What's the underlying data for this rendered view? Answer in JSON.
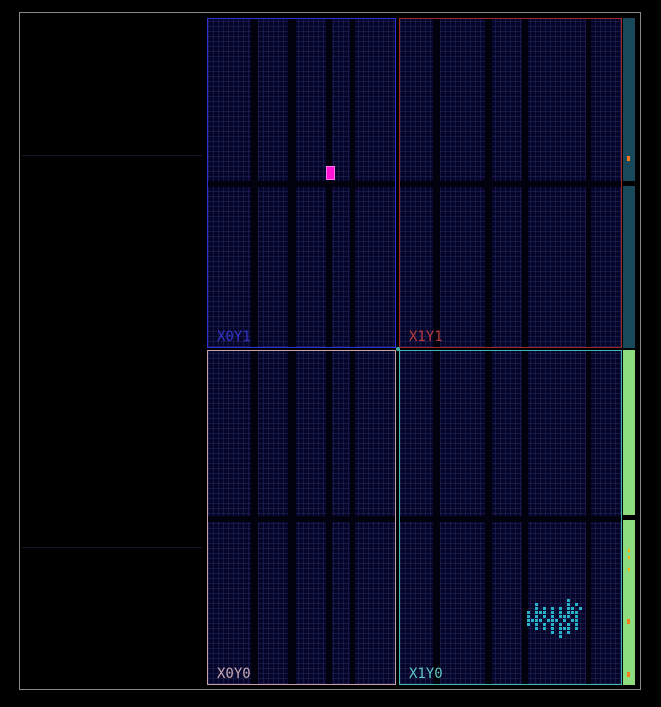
{
  "device_view": {
    "regions": [
      {
        "id": "x0y1",
        "label": "X0Y1",
        "border_color": "#3030d8",
        "label_color": "#3434c8"
      },
      {
        "id": "x1y1",
        "label": "X1Y1",
        "border_color": "#a02828",
        "label_color": "#b83a3a"
      },
      {
        "id": "x0y0",
        "label": "X0Y0",
        "border_color": "#c8a0a8",
        "label_color": "#c8a8b0"
      },
      {
        "id": "x1y0",
        "label": "X1Y0",
        "border_color": "#3fb5b0",
        "label_color": "#5ec7c2"
      }
    ],
    "io_strip_upper_color": "#17495a",
    "io_strip_lower_color": "#8fdc7e",
    "placed_cell_color": "#ff14d6",
    "cluster_cell_color": "#25b3c9"
  }
}
